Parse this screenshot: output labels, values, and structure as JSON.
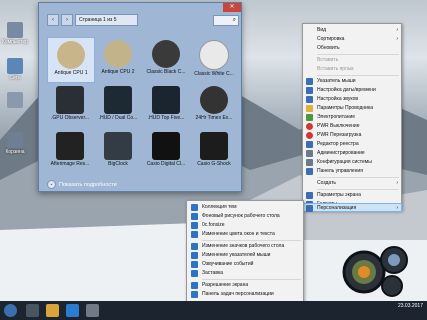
{
  "desktop_icons": [
    {
      "label": "Компьютер",
      "color": "#7a8aa0"
    },
    {
      "label": "Сеть",
      "color": "#5d86b8"
    },
    {
      "label": "Корзина",
      "color": "#6e7f92"
    }
  ],
  "gadgets_window": {
    "page_label": "Страница 1 из 5",
    "search_icon": "search-icon",
    "show_details": "Показать подробности",
    "tiles": [
      {
        "label": "Antique CPU 1",
        "color": "#c8b68a",
        "selected": true
      },
      {
        "label": "Antique CPU 2",
        "color": "#c3b38b",
        "selected": false
      },
      {
        "label": "Classic Black C...",
        "color": "#3a3a3a",
        "selected": false
      },
      {
        "label": "Classic White C...",
        "color": "#e9e9e9",
        "selected": false
      },
      {
        "label": ".GPU Observer...",
        "color": "#2a2f36",
        "selected": false
      },
      {
        "label": ".HUD / Dual Co...",
        "color": "#1d2a33",
        "selected": false
      },
      {
        "label": ".HUD Top Five...",
        "color": "#1a2530",
        "selected": false
      },
      {
        "label": "24Hr Timex Ex...",
        "color": "#333",
        "selected": false
      },
      {
        "label": "Afterimage Res...",
        "color": "#222",
        "selected": false
      },
      {
        "label": "BigClock",
        "color": "#333b45",
        "selected": false
      },
      {
        "label": "Casio Digital Cl...",
        "color": "#111",
        "selected": false
      },
      {
        "label": "Casio G-Shock",
        "color": "#1c1c1c",
        "selected": false
      }
    ]
  },
  "context_menu": {
    "items": [
      {
        "label": "Вид",
        "arrow": "›",
        "disabled": false,
        "icon_color": ""
      },
      {
        "label": "Сортировка",
        "arrow": "›",
        "disabled": false,
        "icon_color": ""
      },
      {
        "label": "Обновить",
        "arrow": "",
        "disabled": false,
        "icon_color": ""
      },
      {
        "label": "Вставить",
        "arrow": "",
        "disabled": true,
        "icon_color": ""
      },
      {
        "label": "Вставить ярлык",
        "arrow": "",
        "disabled": true,
        "icon_color": ""
      },
      {
        "label": "Указатель мыши",
        "arrow": "",
        "disabled": false,
        "icon_color": "#3b6fb5"
      },
      {
        "label": "Настройка даты/времени",
        "arrow": "",
        "disabled": false,
        "icon_color": "#3b6fb5"
      },
      {
        "label": "Настройка звуков",
        "arrow": "",
        "disabled": false,
        "icon_color": "#3b6fb5"
      },
      {
        "label": "Параметры Проводника",
        "arrow": "",
        "disabled": false,
        "icon_color": "#e2b03a"
      },
      {
        "label": "Электропитание",
        "arrow": "",
        "disabled": false,
        "icon_color": "#4a9a3d"
      },
      {
        "label": "PWR Выключение",
        "arrow": "",
        "disabled": false,
        "icon_color": "#d0392f"
      },
      {
        "label": "PWR Перезагрузка",
        "arrow": "",
        "disabled": false,
        "icon_color": "#d0392f"
      },
      {
        "label": "Редактор реестра",
        "arrow": "",
        "disabled": false,
        "icon_color": "#3b6fb5"
      },
      {
        "label": "Администрирование",
        "arrow": "",
        "disabled": false,
        "icon_color": "#6a7a8a"
      },
      {
        "label": "Конфигурация системы",
        "arrow": "",
        "disabled": false,
        "icon_color": "#6a7a8a"
      },
      {
        "label": "Панель управления",
        "arrow": "",
        "disabled": false,
        "icon_color": "#3b6fb5"
      },
      {
        "label": "Создать",
        "arrow": "›",
        "disabled": false,
        "icon_color": ""
      },
      {
        "label": "Параметры экрана",
        "arrow": "",
        "disabled": false,
        "icon_color": "#3b6fb5"
      },
      {
        "label": "Гаджеты",
        "arrow": "",
        "disabled": false,
        "icon_color": "#3b6fb5"
      },
      {
        "label": "Персонализация",
        "arrow": "›",
        "disabled": false,
        "icon_color": "#3b6fb5"
      }
    ]
  },
  "submenu": {
    "items": [
      "Коллекция тем",
      "Фоновый рисунок рабочего стола",
      "0c.fonsize",
      "Изменение цвета окон и текста",
      "Изменение значков рабочего стола",
      "Изменение указателей мыши",
      "Озвучивание событий",
      "Заставка",
      "Разрешение экрана",
      "Панель задач персонализации"
    ]
  },
  "taskbar": {
    "time": "",
    "date": "23.03.2017"
  }
}
